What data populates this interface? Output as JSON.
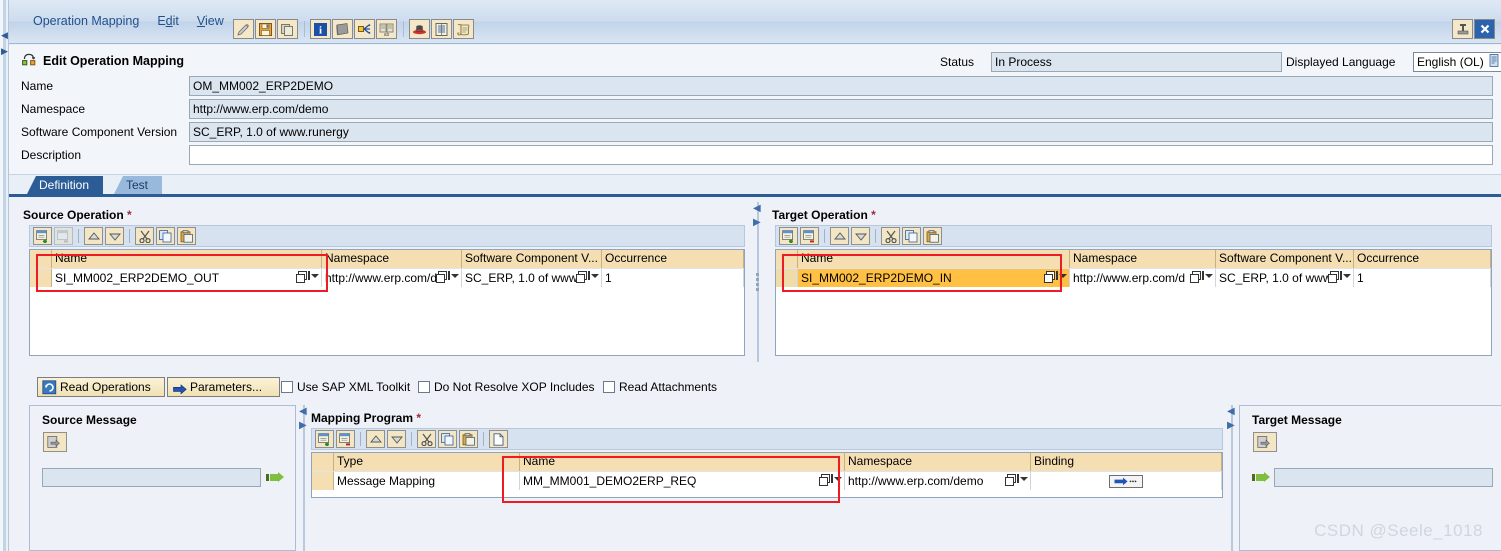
{
  "window": {
    "title": "Edit Operation Mapping",
    "title_icon": "operation-mapping-icon",
    "restore_icon": "restore-window-icon",
    "close_icon": "close-window-icon"
  },
  "menubar": {
    "items": [
      {
        "label": "Operation Mapping",
        "underline": ""
      },
      {
        "label": "Edit",
        "underline": "E"
      },
      {
        "label": "View",
        "underline": "V"
      }
    ],
    "toolbar_groups": [
      {
        "buttons": [
          {
            "name": "edit-tool-icon",
            "glyph": "✎"
          },
          {
            "name": "save-icon",
            "glyph": "💾"
          },
          {
            "name": "copy-icon",
            "glyph": "❐"
          }
        ]
      },
      {
        "buttons": [
          {
            "name": "info-icon",
            "glyph": "i"
          },
          {
            "name": "book-icon",
            "glyph": "📘"
          },
          {
            "name": "where-used-icon",
            "glyph": "⇵"
          },
          {
            "name": "compare-icon",
            "glyph": "☷"
          }
        ]
      },
      {
        "buttons": [
          {
            "name": "hat-icon",
            "glyph": "⛑"
          },
          {
            "name": "list-icon",
            "glyph": "☰"
          },
          {
            "name": "scroll-icon",
            "glyph": "📜"
          }
        ]
      }
    ]
  },
  "header": {
    "fields": [
      {
        "label": "Name",
        "value": "OM_MM002_ERP2DEMO",
        "readonly": true
      },
      {
        "label": "Namespace",
        "value": "http://www.erp.com/demo",
        "readonly": true
      },
      {
        "label": "Software Component Version",
        "value": "SC_ERP, 1.0 of www.runergy",
        "readonly": true
      },
      {
        "label": "Description",
        "value": "",
        "readonly": false
      }
    ],
    "status_label": "Status",
    "status_value": "In Process",
    "language_label": "Displayed Language",
    "language_value": "English (OL)"
  },
  "tabs": [
    {
      "label": "Definition",
      "active": true
    },
    {
      "label": "Test",
      "active": false
    }
  ],
  "source_operation": {
    "title": "Source Operation",
    "required_marker": "*",
    "toolbar": [
      {
        "name": "insert-row-icon",
        "enabled": true
      },
      {
        "name": "delete-row-icon",
        "enabled": false
      },
      {
        "name": "move-up-icon",
        "enabled": true
      },
      {
        "name": "move-down-icon",
        "enabled": true
      },
      {
        "name": "cut-icon",
        "enabled": true
      },
      {
        "name": "copy-icon",
        "enabled": true
      },
      {
        "name": "paste-icon",
        "enabled": true
      }
    ],
    "columns": [
      "Name",
      "Namespace",
      "Software Component V...",
      "Occurrence"
    ],
    "rows": [
      {
        "name": "SI_MM002_ERP2DEMO_OUT",
        "namespace": "http://www.erp.com/d",
        "swcv": "SC_ERP, 1.0 of www",
        "occurrence": "1",
        "selected": false
      }
    ]
  },
  "target_operation": {
    "title": "Target Operation",
    "required_marker": "*",
    "toolbar": [
      {
        "name": "insert-row-icon",
        "enabled": true
      },
      {
        "name": "delete-row-icon",
        "enabled": true
      },
      {
        "name": "move-up-icon",
        "enabled": true
      },
      {
        "name": "move-down-icon",
        "enabled": true
      },
      {
        "name": "cut-icon",
        "enabled": true
      },
      {
        "name": "copy-icon",
        "enabled": true
      },
      {
        "name": "paste-icon",
        "enabled": true
      }
    ],
    "columns": [
      "Name",
      "Namespace",
      "Software Component V...",
      "Occurrence"
    ],
    "rows": [
      {
        "name": "SI_MM002_ERP2DEMO_IN",
        "namespace": "http://www.erp.com/d",
        "swcv": "SC_ERP, 1.0 of www",
        "occurrence": "1",
        "selected": true
      }
    ]
  },
  "action_bar": {
    "read_operations_label": "Read Operations",
    "read_operations_icon": "refresh-icon",
    "parameters_label": "Parameters...",
    "parameters_icon": "blue-arrow-icon",
    "checkboxes": [
      {
        "label": "Use SAP XML Toolkit",
        "checked": false
      },
      {
        "label": "Do Not Resolve XOP Includes",
        "checked": false
      },
      {
        "label": "Read Attachments",
        "checked": false
      }
    ]
  },
  "source_message": {
    "title": "Source Message",
    "open_icon": "open-object-icon",
    "field_value": "",
    "flow_icon": "green-arrow-icon"
  },
  "mapping_program": {
    "title": "Mapping Program",
    "required_marker": "*",
    "toolbar": [
      {
        "name": "insert-row-icon",
        "enabled": true
      },
      {
        "name": "delete-row-icon",
        "enabled": true
      },
      {
        "name": "move-up-icon",
        "enabled": true
      },
      {
        "name": "move-down-icon",
        "enabled": true
      },
      {
        "name": "cut-icon",
        "enabled": true
      },
      {
        "name": "copy-icon",
        "enabled": true
      },
      {
        "name": "paste-icon",
        "enabled": true
      },
      {
        "name": "new-document-icon",
        "enabled": true
      }
    ],
    "columns": [
      "Type",
      "Name",
      "Namespace",
      "Binding"
    ],
    "rows": [
      {
        "type": "Message Mapping",
        "name": "MM_MM001_DEMO2ERP_REQ",
        "namespace": "http://www.erp.com/demo",
        "binding_icon": "binding-arrow-icon"
      }
    ]
  },
  "target_message": {
    "title": "Target Message",
    "open_icon": "open-object-icon",
    "field_value": "",
    "flow_icon": "green-arrow-icon"
  },
  "watermark": "CSDN @Seele_1018",
  "colors": {
    "accent": "#2c5c96",
    "selected_row": "#ffc043",
    "grid_header": "#f5dfb2",
    "annotation": "#ed1c24",
    "readonly_field": "#dbe5f0"
  }
}
